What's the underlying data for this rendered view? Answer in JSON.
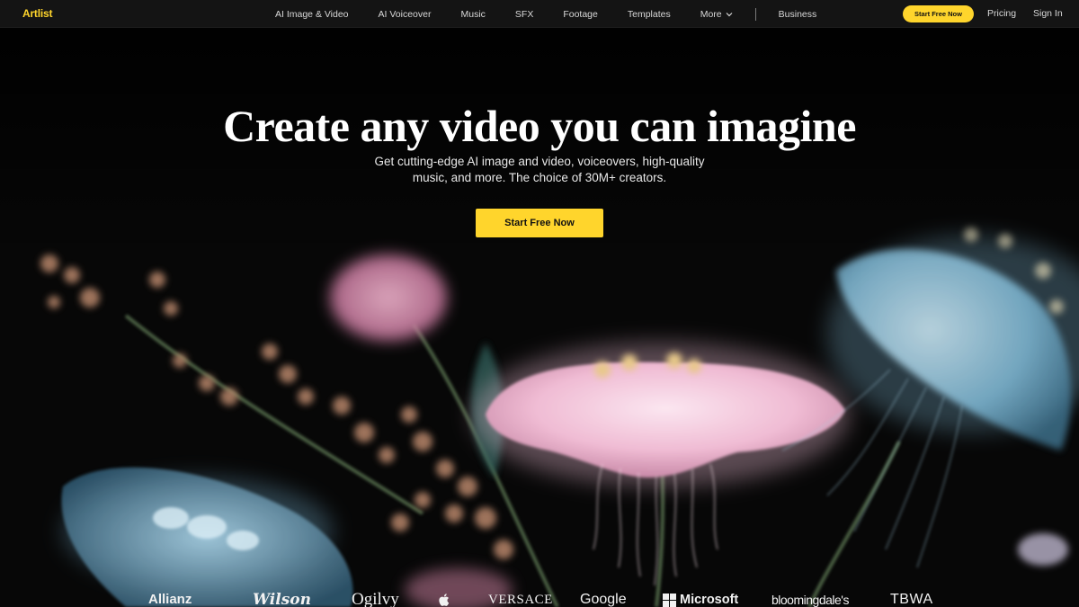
{
  "brand": {
    "name": "Artlist",
    "color": "#ffd52c"
  },
  "nav": {
    "links": [
      {
        "label": "AI Image & Video"
      },
      {
        "label": "AI Voiceover"
      },
      {
        "label": "Music"
      },
      {
        "label": "SFX"
      },
      {
        "label": "Footage"
      },
      {
        "label": "Templates"
      },
      {
        "label": "More"
      }
    ],
    "business": "Business",
    "cta": "Start Free Now",
    "pricing": "Pricing",
    "signin": "Sign In"
  },
  "hero": {
    "title": "Create any video you can imagine",
    "subtitle_line1": "Get cutting-edge AI image and video, voiceovers, high-quality",
    "subtitle_line2": "music, and more. The choice of 30M+ creators.",
    "cta": "Start Free Now"
  },
  "brands": [
    "Allianz",
    "Wilson",
    "Ogilvy",
    "Apple",
    "VERSACE",
    "Google",
    "Microsoft",
    "bloomingdale's",
    "TBWA"
  ],
  "colors": {
    "accent": "#ffd52c",
    "background": "#0b0b0b",
    "nav_bg": "#141414"
  }
}
